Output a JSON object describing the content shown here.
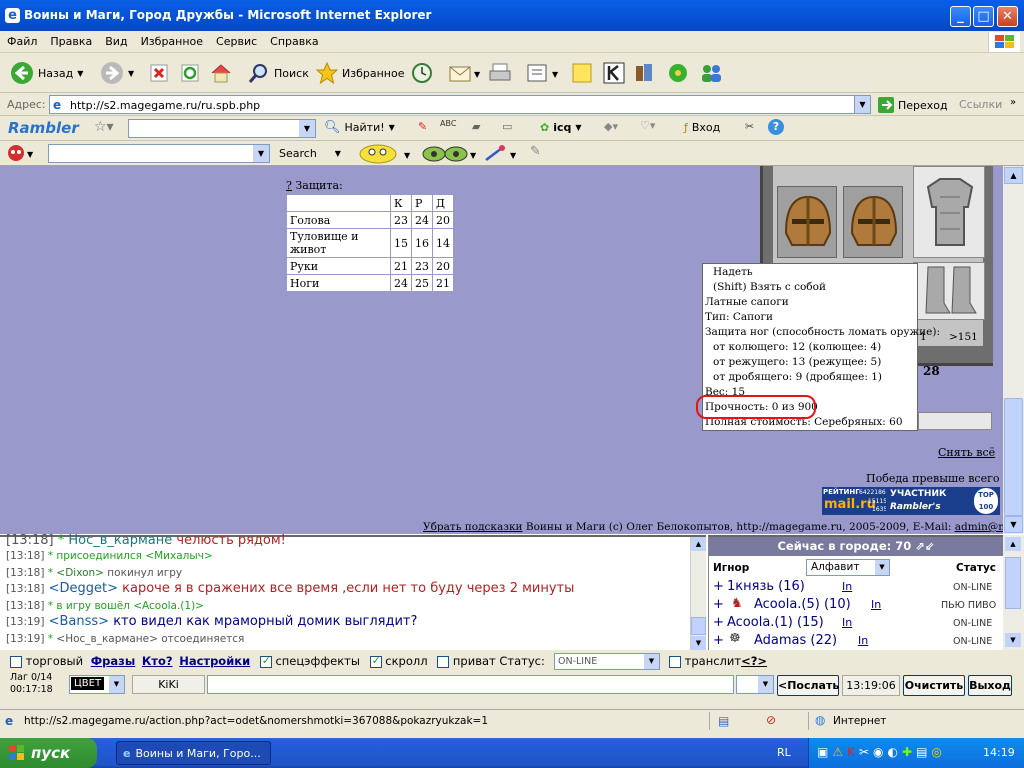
{
  "window": {
    "title": "Воины и Маги, Город Дружбы - Microsoft Internet Explorer",
    "min": "_",
    "max": "□",
    "close": "✕"
  },
  "menu": [
    "Файл",
    "Правка",
    "Вид",
    "Избранное",
    "Сервис",
    "Справка"
  ],
  "toolbar": {
    "back": "Назад",
    "search": "Поиск",
    "favorites": "Избранное"
  },
  "address": {
    "label": "Адрес:",
    "url": "http://s2.magegame.ru/ru.spb.php",
    "go": "Переход",
    "links": "Ссылки"
  },
  "rambler": {
    "logo": "Rambler",
    "find": "Найти!",
    "icq": "icq",
    "login": "Вход"
  },
  "search2": {
    "label": "Search"
  },
  "game": {
    "protection_label": "? Защита:",
    "protection_help": "?",
    "protection_title": "Защита:",
    "cols": [
      "К",
      "Р",
      "Д"
    ],
    "rows": [
      {
        "name": "Голова",
        "v": [
          "23",
          "24",
          "20"
        ]
      },
      {
        "name": "Туловище и живот",
        "v": [
          "15",
          "16",
          "14"
        ]
      },
      {
        "name": "Руки",
        "v": [
          "21",
          "23",
          "20"
        ]
      },
      {
        "name": "Ноги",
        "v": [
          "24",
          "25",
          "21"
        ]
      }
    ],
    "tooltip": {
      "wear": "Надеть",
      "take": "(Shift) Взять с собой",
      "name": "Латные сапоги",
      "type": "Тип: Сапоги",
      "prot": "Защита ног (способность ломать оружие):",
      "p1": "от колющего: 12 (колющее: 4)",
      "p2": "от режущего: 13 (режущее: 5)",
      "p3": "от дробящего: 9 (дробящее: 1)",
      "weight": "Вес: 15",
      "durability": "Прочность: 0 из 900",
      "cost": "Полная стоимость: Серебряных: 60"
    },
    "slot1": "1",
    "slot2": ">151",
    "num28": "28",
    "remove_all": "Снять всё",
    "victory": "Победа превыше всего",
    "footer_link": "Убрать подсказки",
    "footer_text": " Воины и Маги (c) Олег Белокопытов, http://magegame.ru, 2005-2009, E-Mail: ",
    "footer_mail": "admin@magegame.ru",
    "rating": {
      "l1": "РЕЙТИНГ",
      "n1": "642218636",
      "brand": "mail.ru",
      "n2": "151153",
      "n3": "1635"
    },
    "rambler_badge": {
      "top": "УЧАСТНИК",
      "bottom": "Rambler's",
      "num": "TOP 100"
    }
  },
  "chat": [
    {
      "time": "[13:18]",
      "mark": "*",
      "text": "Нос_в_кармане",
      "rest": " челюсть рядом!",
      "type": "big"
    },
    {
      "time": "[13:18]",
      "mark": "*",
      "text": "присоединился ",
      "nick": "<Михалыч>",
      "type": "sys"
    },
    {
      "time": "[13:18]",
      "mark": "*",
      "text": "<Dixon>",
      "rest": " покинул игру",
      "type": "sys2"
    },
    {
      "time": "[13:18]",
      "nick": "<Degget>",
      "text": " кароче я в сражених все время ,если нет то буду через 2 минуты",
      "type": "say"
    },
    {
      "time": "[13:18]",
      "mark": "*",
      "text": "в игру вошёл ",
      "nick": "<Acoola.(1)>",
      "type": "sys"
    },
    {
      "time": "[13:19]",
      "nick": "<Banss>",
      "text": " кто видел как мраморный домик выглядит?",
      "type": "say2"
    },
    {
      "time": "[13:19]",
      "mark": "*",
      "text": "<Нос_в_кармане>",
      "rest": " отсоединяется",
      "type": "sys2"
    }
  ],
  "who": {
    "title": "Сейчас в городе: 70",
    "ignore": "Игнор",
    "sort": "Алфавит",
    "status": "Статус",
    "players": [
      {
        "name": "1князь (16)",
        "link": "In",
        "status": "ON-LINE"
      },
      {
        "name": "Acoola.(5) (10)",
        "link": "In",
        "status": "ПЬЮ ПИВО"
      },
      {
        "name": "Acoola.(1) (15)",
        "link": "In",
        "status": "ON-LINE"
      },
      {
        "name": "Adamas (22)",
        "link": "In",
        "status": "ON-LINE"
      }
    ]
  },
  "controls": {
    "trade": "торговый",
    "phrases": "Фразы",
    "who": "Кто?",
    "settings": "Настройки",
    "effects": "спецэффекты",
    "scroll": "скролл",
    "private": "приват",
    "status_label": "Статус:",
    "status_value": "ON-LINE",
    "translit": "транслит",
    "translit_help": "<?>",
    "lag": "Лаг 0/14",
    "clock": "00:17:18",
    "color": "ЦВЕТ",
    "nick": "KiKi",
    "send": "<Послать",
    "time": "13:19:06",
    "clear": "Очистить",
    "exit": "Выход"
  },
  "status": {
    "url": "http://s2.magegame.ru/action.php?act=odet&nomershmotki=367088&pokazryukzak=1",
    "zone": "Интернет"
  },
  "taskbar": {
    "start": "пуск",
    "task": "Воины и Маги, Горо...",
    "lang": "RL",
    "time": "14:19"
  }
}
